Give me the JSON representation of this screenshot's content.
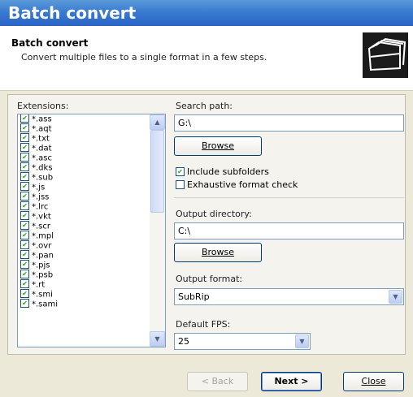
{
  "window": {
    "title": "Batch convert"
  },
  "header": {
    "title": "Batch convert",
    "subtitle": "Convert multiple files to a single format in a few steps."
  },
  "extensions": {
    "label": "Extensions:",
    "items": [
      "*.ass",
      "*.aqt",
      "*.txt",
      "*.dat",
      "*.asc",
      "*.dks",
      "*.sub",
      "*.js",
      "*.jss",
      "*.lrc",
      "*.vkt",
      "*.scr",
      "*.mpl",
      "*.ovr",
      "*.pan",
      "*.pjs",
      "*.psb",
      "*.rt",
      "*.smi",
      "*.sami"
    ],
    "checked": true
  },
  "search": {
    "label": "Search path:",
    "value": "G:\\",
    "browse_label": "Browse"
  },
  "options": {
    "include_subfolders": {
      "label": "Include subfolders",
      "checked": true
    },
    "exhaustive_check": {
      "label": "Exhaustive format check",
      "checked": false
    }
  },
  "output": {
    "label": "Output directory:",
    "value": "C:\\",
    "browse_label": "Browse"
  },
  "format": {
    "label": "Output format:",
    "value": "SubRip"
  },
  "fps": {
    "label": "Default FPS:",
    "value": "25"
  },
  "footer": {
    "back_label": "< Back",
    "next_label": "Next >",
    "close_label": "Close"
  },
  "colors": {
    "titlebar": "#2a63c4",
    "panel": "#ece9d8",
    "checkmark": "#21a121"
  }
}
